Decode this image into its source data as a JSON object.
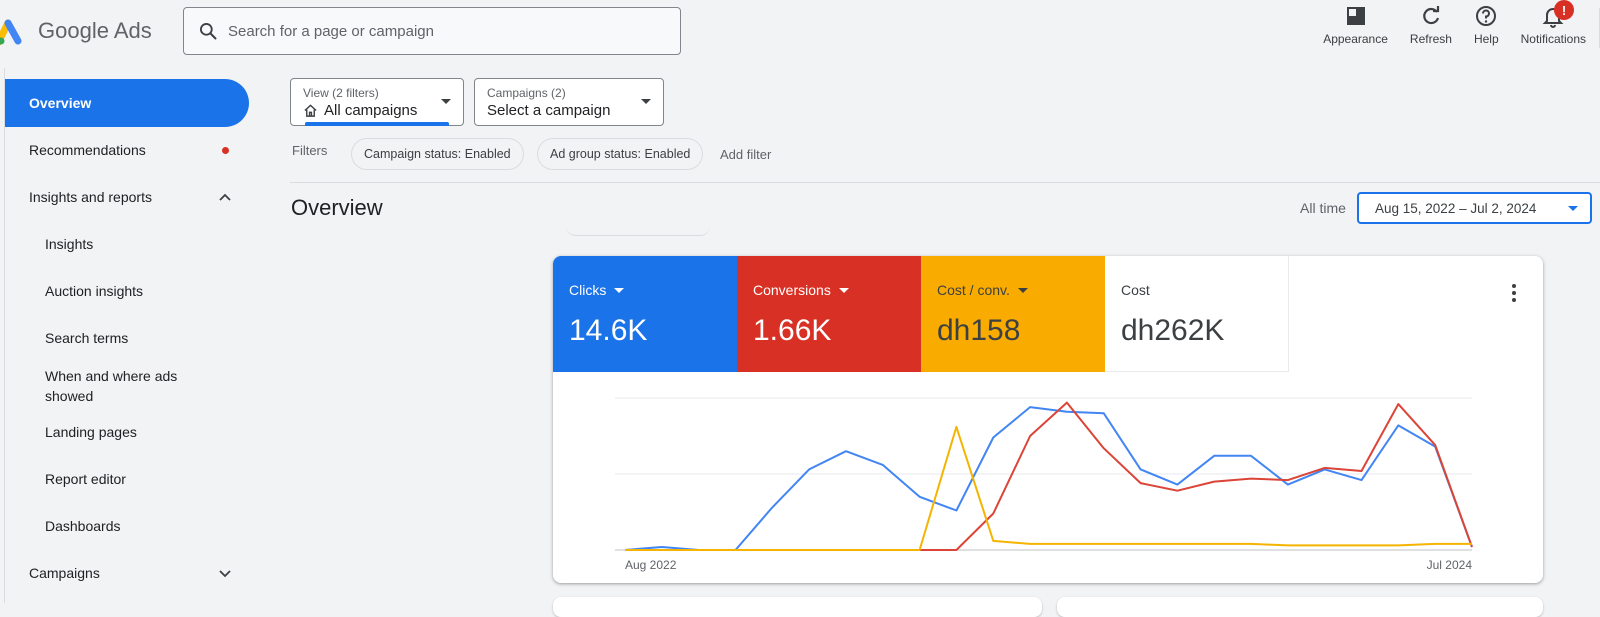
{
  "app": {
    "logo_text": "Google Ads"
  },
  "search": {
    "placeholder": "Search for a page or campaign"
  },
  "top_actions": [
    {
      "label": "Appearance",
      "icon": "appearance-icon"
    },
    {
      "label": "Refresh",
      "icon": "refresh-icon"
    },
    {
      "label": "Help",
      "icon": "help-icon"
    },
    {
      "label": "Notifications",
      "icon": "bell-icon",
      "badge": "!"
    }
  ],
  "sidebar": {
    "items": [
      {
        "label": "Overview",
        "active": true
      },
      {
        "label": "Recommendations",
        "dot": true
      },
      {
        "label": "Insights and reports",
        "expanded": true
      },
      {
        "label": "Insights",
        "sub": true
      },
      {
        "label": "Auction insights",
        "sub": true
      },
      {
        "label": "Search terms",
        "sub": true
      },
      {
        "label": "When and where ads showed",
        "sub": true
      },
      {
        "label": "Landing pages",
        "sub": true
      },
      {
        "label": "Report editor",
        "sub": true
      },
      {
        "label": "Dashboards",
        "sub": true
      },
      {
        "label": "Campaigns",
        "expanded": false
      }
    ]
  },
  "view_select": {
    "small": "View (2 filters)",
    "value": "All campaigns"
  },
  "campaign_select": {
    "small": "Campaigns (2)",
    "value": "Select a campaign"
  },
  "filters": {
    "label": "Filters",
    "chips": [
      "Campaign status: Enabled",
      "Ad group status: Enabled"
    ],
    "add_label": "Add filter"
  },
  "page": {
    "title": "Overview",
    "range_label": "All time",
    "date_range": "Aug 15, 2022 – Jul 2, 2024"
  },
  "metrics": [
    {
      "name": "Clicks",
      "value": "14.6K",
      "color": "#1a73e8",
      "text_color": "#ffffff",
      "dropdown": true
    },
    {
      "name": "Conversions",
      "value": "1.66K",
      "color": "#d93025",
      "text_color": "#ffffff",
      "dropdown": true
    },
    {
      "name": "Cost / conv.",
      "value": "dh158",
      "color": "#f9ab00",
      "text_color": "#3c4043",
      "dropdown": true
    },
    {
      "name": "Cost",
      "value": "dh262K",
      "color": "#ffffff",
      "text_color": "#3c4043",
      "dropdown": false
    }
  ],
  "chart_data": {
    "type": "line",
    "x_start_label": "Aug 2022",
    "x_end_label": "Jul 2024",
    "points_per_series": 24,
    "series": [
      {
        "name": "Clicks",
        "color": "#4285f4",
        "values": [
          0,
          2,
          0,
          0,
          28,
          53,
          65,
          56,
          35,
          26,
          74,
          94,
          91,
          90,
          53,
          43,
          62,
          62,
          43,
          53,
          46,
          82,
          68,
          2
        ]
      },
      {
        "name": "Conversions",
        "color": "#db4437",
        "values": [
          0,
          0,
          0,
          0,
          0,
          0,
          0,
          0,
          0,
          0,
          24,
          75,
          97,
          67,
          44,
          39,
          45,
          47,
          46,
          54,
          52,
          96,
          69,
          2
        ]
      },
      {
        "name": "Cost / conv.",
        "color": "#f4b400",
        "values": [
          0,
          0,
          0,
          0,
          0,
          0,
          0,
          0,
          0,
          81,
          6,
          4,
          4,
          4,
          4,
          4,
          4,
          4,
          3,
          3,
          3,
          3,
          4,
          4
        ]
      }
    ]
  }
}
